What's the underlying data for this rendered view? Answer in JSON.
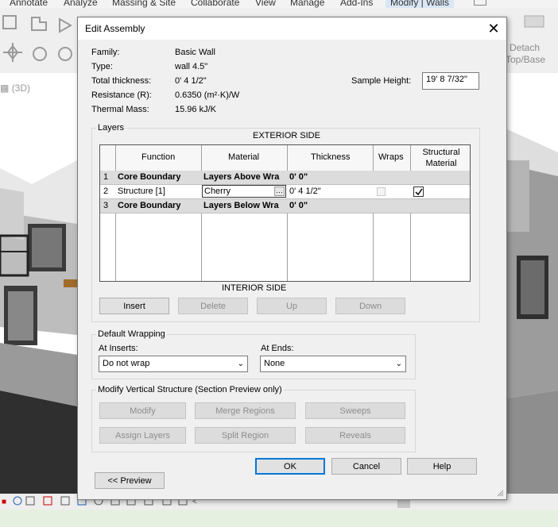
{
  "ribbon": {
    "tabs": [
      "Annotate",
      "Analyze",
      "Massing & Site",
      "Collaborate",
      "View",
      "Manage",
      "Add-Ins",
      "Modify | Walls"
    ],
    "detach_label_1": "Detach",
    "detach_label_2": "Top/Base"
  },
  "view": {
    "name": "(3D)"
  },
  "dialog": {
    "title": "Edit Assembly",
    "info": {
      "family_label": "Family:",
      "family_value": "Basic Wall",
      "type_label": "Type:",
      "type_value": "wall 4.5\"",
      "thickness_label": "Total thickness:",
      "thickness_value": "0'  4 1/2\"",
      "resistance_label": "Resistance (R):",
      "resistance_value": "0.6350 (m²·K)/W",
      "mass_label": "Thermal Mass:",
      "mass_value": "15.96 kJ/K",
      "sample_height_label": "Sample Height:",
      "sample_height_value": "19'  8 7/32\""
    },
    "layers": {
      "group_label": "Layers",
      "exterior_side": "EXTERIOR SIDE",
      "interior_side": "INTERIOR SIDE",
      "headers": {
        "function": "Function",
        "material": "Material",
        "thickness": "Thickness",
        "wraps": "Wraps",
        "structural": "Structural Material"
      },
      "rows": [
        {
          "num": "1",
          "function": "Core Boundary",
          "material": "Layers Above Wra",
          "thickness": "0'  0\"",
          "bold": true
        },
        {
          "num": "2",
          "function": "Structure [1]",
          "material": "Cherry",
          "thickness": "0'  4 1/2\"",
          "wraps": false,
          "structural": true,
          "bold": false
        },
        {
          "num": "3",
          "function": "Core Boundary",
          "material": "Layers Below Wra",
          "thickness": "0'  0\"",
          "bold": true
        }
      ],
      "buttons": {
        "insert": "Insert",
        "delete": "Delete",
        "up": "Up",
        "down": "Down"
      }
    },
    "wrapping": {
      "group_label": "Default Wrapping",
      "inserts_label": "At Inserts:",
      "inserts_value": "Do not wrap",
      "ends_label": "At Ends:",
      "ends_value": "None"
    },
    "vertical": {
      "group_label": "Modify Vertical Structure (Section Preview only)",
      "modify": "Modify",
      "merge": "Merge Regions",
      "sweeps": "Sweeps",
      "assign": "Assign Layers",
      "split": "Split Region",
      "reveals": "Reveals"
    },
    "footer": {
      "ok": "OK",
      "cancel": "Cancel",
      "help": "Help",
      "preview": "<< Preview"
    }
  }
}
